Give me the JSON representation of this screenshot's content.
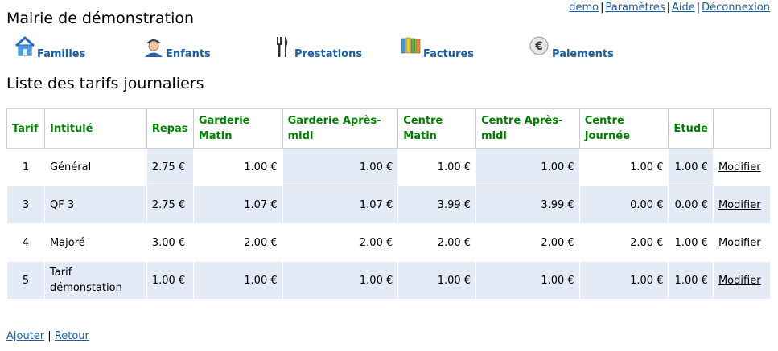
{
  "site": {
    "title": "Mairie de démonstration"
  },
  "top_links": [
    {
      "label": "demo"
    },
    {
      "label": "Paramètres"
    },
    {
      "label": "Aide"
    },
    {
      "label": "Déconnexion"
    }
  ],
  "separator": "|",
  "nav": [
    {
      "label": "Familles",
      "icon": "house-icon"
    },
    {
      "label": "Enfants",
      "icon": "child-icon"
    },
    {
      "label": "Prestations",
      "icon": "cutlery-icon"
    },
    {
      "label": "Factures",
      "icon": "binders-icon"
    },
    {
      "label": "Paiements",
      "icon": "euro-icon",
      "glyph": "€"
    }
  ],
  "page_title": "Liste des tarifs journaliers",
  "table": {
    "headers": [
      "Tarif",
      "Intitulé",
      "Repas",
      "Garderie Matin",
      "Garderie Après-midi",
      "Centre Matin",
      "Centre Après-midi",
      "Centre Journée",
      "Etude",
      ""
    ],
    "rows": [
      {
        "tarif": "1",
        "intitule": "Général",
        "repas": "2.75 €",
        "garderie_matin": "1.00 €",
        "garderie_apres_midi": "1.00 €",
        "centre_matin": "1.00 €",
        "centre_apres_midi": "1.00 €",
        "centre_journee": "1.00 €",
        "etude": "1.00 €",
        "action": "Modifier"
      },
      {
        "tarif": "3",
        "intitule": "QF 3",
        "repas": "2.75 €",
        "garderie_matin": "1.07 €",
        "garderie_apres_midi": "1.07 €",
        "centre_matin": "3.99 €",
        "centre_apres_midi": "3.99 €",
        "centre_journee": "0.00 €",
        "etude": "0.00 €",
        "action": "Modifier"
      },
      {
        "tarif": "4",
        "intitule": "Majoré",
        "repas": "3.00 €",
        "garderie_matin": "2.00 €",
        "garderie_apres_midi": "2.00 €",
        "centre_matin": "2.00 €",
        "centre_apres_midi": "2.00 €",
        "centre_journee": "2.00 €",
        "etude": "1.00 €",
        "action": "Modifier"
      },
      {
        "tarif": "5",
        "intitule": "Tarif démonstation",
        "repas": "1.00 €",
        "garderie_matin": "1.00 €",
        "garderie_apres_midi": "1.00 €",
        "centre_matin": "1.00 €",
        "centre_apres_midi": "1.00 €",
        "centre_journee": "1.00 €",
        "etude": "1.00 €",
        "action": "Modifier"
      }
    ]
  },
  "bottom_links": [
    {
      "label": "Ajouter"
    },
    {
      "label": "Retour"
    }
  ],
  "colors": {
    "header_text": "#008000",
    "link": "#1a5fa8",
    "row_shade": "#e4ebf7"
  }
}
